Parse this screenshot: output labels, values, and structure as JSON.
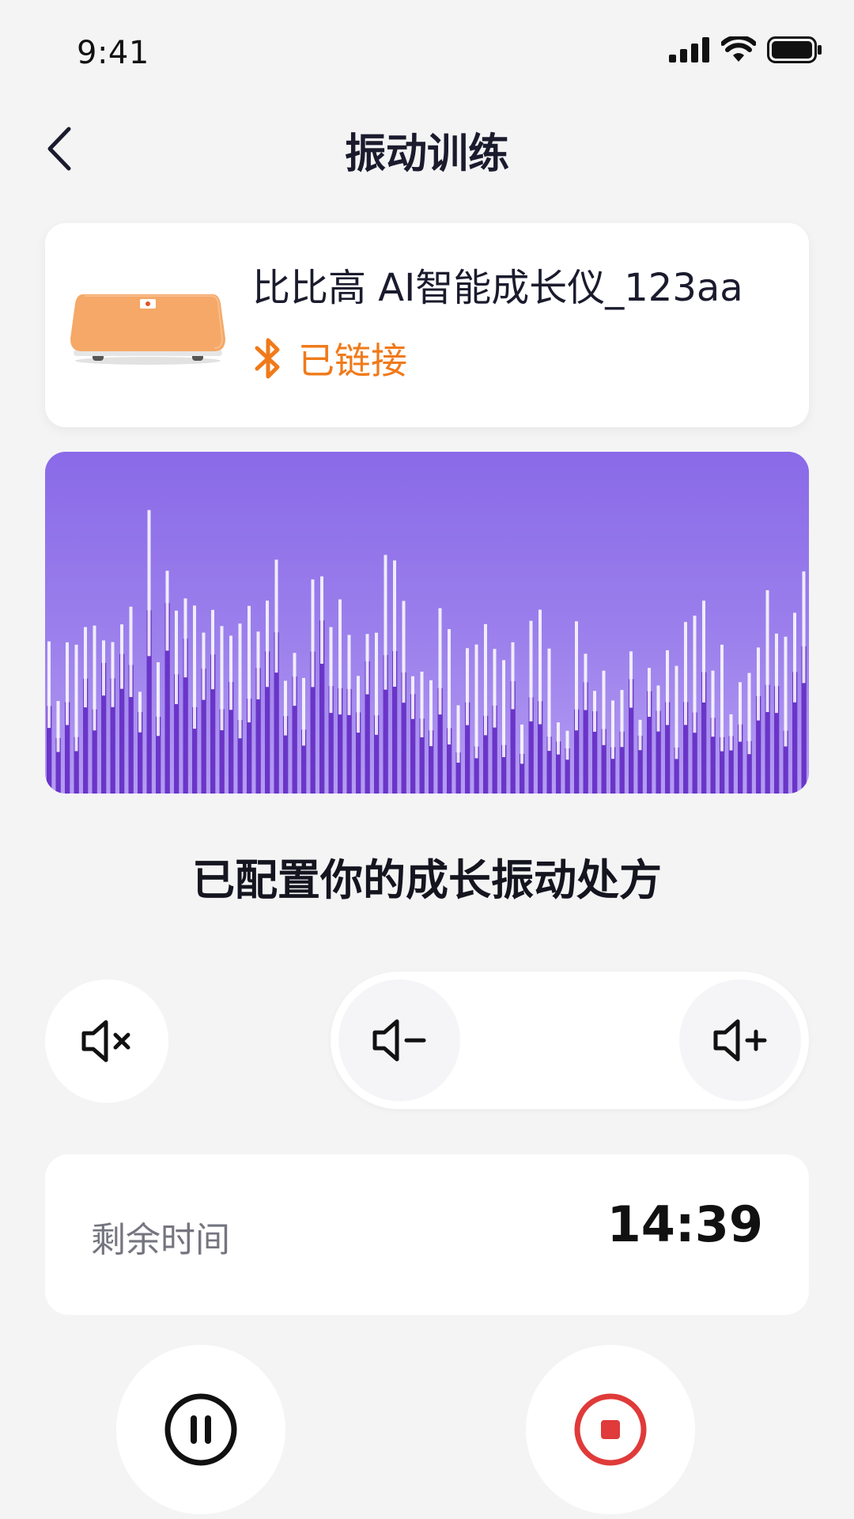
{
  "status_bar": {
    "time": "9:41"
  },
  "nav": {
    "title": "振动训练"
  },
  "device": {
    "name": "比比高 AI智能成长仪_123aa",
    "status": "已链接",
    "status_color": "#f07a1a"
  },
  "wave": {
    "bg_top": "#8a6ae8",
    "bg_bottom": "#b49cf2",
    "bar_color": "#6a35c8",
    "highlight_color": "#ffffff"
  },
  "config_message": "已配置你的成长振动处方",
  "volume": {
    "mute_icon": "speaker-mute-icon",
    "down_icon": "speaker-minus-icon",
    "up_icon": "speaker-plus-icon"
  },
  "timer": {
    "label": "剩余时间",
    "value": "14:39"
  },
  "controls": {
    "pause_icon": "pause-icon",
    "stop_icon": "stop-icon",
    "stop_color": "#e03a3a"
  }
}
